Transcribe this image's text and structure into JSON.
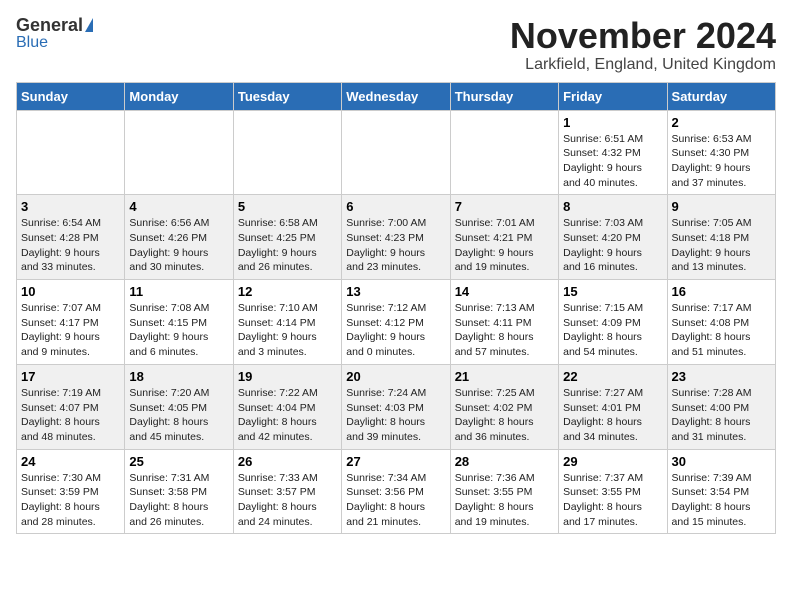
{
  "header": {
    "logo_general": "General",
    "logo_blue": "Blue",
    "month_title": "November 2024",
    "location": "Larkfield, England, United Kingdom"
  },
  "weekdays": [
    "Sunday",
    "Monday",
    "Tuesday",
    "Wednesday",
    "Thursday",
    "Friday",
    "Saturday"
  ],
  "weeks": [
    [
      {
        "day": "",
        "info": ""
      },
      {
        "day": "",
        "info": ""
      },
      {
        "day": "",
        "info": ""
      },
      {
        "day": "",
        "info": ""
      },
      {
        "day": "",
        "info": ""
      },
      {
        "day": "1",
        "info": "Sunrise: 6:51 AM\nSunset: 4:32 PM\nDaylight: 9 hours\nand 40 minutes."
      },
      {
        "day": "2",
        "info": "Sunrise: 6:53 AM\nSunset: 4:30 PM\nDaylight: 9 hours\nand 37 minutes."
      }
    ],
    [
      {
        "day": "3",
        "info": "Sunrise: 6:54 AM\nSunset: 4:28 PM\nDaylight: 9 hours\nand 33 minutes."
      },
      {
        "day": "4",
        "info": "Sunrise: 6:56 AM\nSunset: 4:26 PM\nDaylight: 9 hours\nand 30 minutes."
      },
      {
        "day": "5",
        "info": "Sunrise: 6:58 AM\nSunset: 4:25 PM\nDaylight: 9 hours\nand 26 minutes."
      },
      {
        "day": "6",
        "info": "Sunrise: 7:00 AM\nSunset: 4:23 PM\nDaylight: 9 hours\nand 23 minutes."
      },
      {
        "day": "7",
        "info": "Sunrise: 7:01 AM\nSunset: 4:21 PM\nDaylight: 9 hours\nand 19 minutes."
      },
      {
        "day": "8",
        "info": "Sunrise: 7:03 AM\nSunset: 4:20 PM\nDaylight: 9 hours\nand 16 minutes."
      },
      {
        "day": "9",
        "info": "Sunrise: 7:05 AM\nSunset: 4:18 PM\nDaylight: 9 hours\nand 13 minutes."
      }
    ],
    [
      {
        "day": "10",
        "info": "Sunrise: 7:07 AM\nSunset: 4:17 PM\nDaylight: 9 hours\nand 9 minutes."
      },
      {
        "day": "11",
        "info": "Sunrise: 7:08 AM\nSunset: 4:15 PM\nDaylight: 9 hours\nand 6 minutes."
      },
      {
        "day": "12",
        "info": "Sunrise: 7:10 AM\nSunset: 4:14 PM\nDaylight: 9 hours\nand 3 minutes."
      },
      {
        "day": "13",
        "info": "Sunrise: 7:12 AM\nSunset: 4:12 PM\nDaylight: 9 hours\nand 0 minutes."
      },
      {
        "day": "14",
        "info": "Sunrise: 7:13 AM\nSunset: 4:11 PM\nDaylight: 8 hours\nand 57 minutes."
      },
      {
        "day": "15",
        "info": "Sunrise: 7:15 AM\nSunset: 4:09 PM\nDaylight: 8 hours\nand 54 minutes."
      },
      {
        "day": "16",
        "info": "Sunrise: 7:17 AM\nSunset: 4:08 PM\nDaylight: 8 hours\nand 51 minutes."
      }
    ],
    [
      {
        "day": "17",
        "info": "Sunrise: 7:19 AM\nSunset: 4:07 PM\nDaylight: 8 hours\nand 48 minutes."
      },
      {
        "day": "18",
        "info": "Sunrise: 7:20 AM\nSunset: 4:05 PM\nDaylight: 8 hours\nand 45 minutes."
      },
      {
        "day": "19",
        "info": "Sunrise: 7:22 AM\nSunset: 4:04 PM\nDaylight: 8 hours\nand 42 minutes."
      },
      {
        "day": "20",
        "info": "Sunrise: 7:24 AM\nSunset: 4:03 PM\nDaylight: 8 hours\nand 39 minutes."
      },
      {
        "day": "21",
        "info": "Sunrise: 7:25 AM\nSunset: 4:02 PM\nDaylight: 8 hours\nand 36 minutes."
      },
      {
        "day": "22",
        "info": "Sunrise: 7:27 AM\nSunset: 4:01 PM\nDaylight: 8 hours\nand 34 minutes."
      },
      {
        "day": "23",
        "info": "Sunrise: 7:28 AM\nSunset: 4:00 PM\nDaylight: 8 hours\nand 31 minutes."
      }
    ],
    [
      {
        "day": "24",
        "info": "Sunrise: 7:30 AM\nSunset: 3:59 PM\nDaylight: 8 hours\nand 28 minutes."
      },
      {
        "day": "25",
        "info": "Sunrise: 7:31 AM\nSunset: 3:58 PM\nDaylight: 8 hours\nand 26 minutes."
      },
      {
        "day": "26",
        "info": "Sunrise: 7:33 AM\nSunset: 3:57 PM\nDaylight: 8 hours\nand 24 minutes."
      },
      {
        "day": "27",
        "info": "Sunrise: 7:34 AM\nSunset: 3:56 PM\nDaylight: 8 hours\nand 21 minutes."
      },
      {
        "day": "28",
        "info": "Sunrise: 7:36 AM\nSunset: 3:55 PM\nDaylight: 8 hours\nand 19 minutes."
      },
      {
        "day": "29",
        "info": "Sunrise: 7:37 AM\nSunset: 3:55 PM\nDaylight: 8 hours\nand 17 minutes."
      },
      {
        "day": "30",
        "info": "Sunrise: 7:39 AM\nSunset: 3:54 PM\nDaylight: 8 hours\nand 15 minutes."
      }
    ]
  ]
}
